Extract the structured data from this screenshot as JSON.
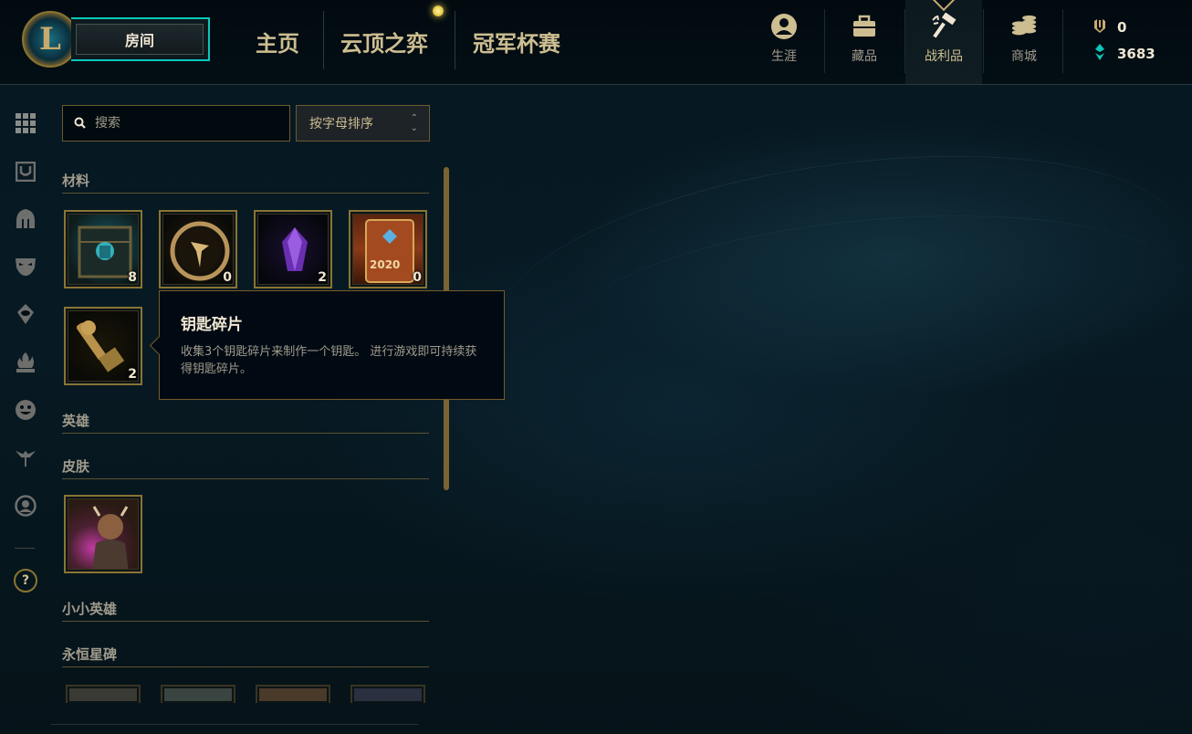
{
  "header": {
    "play_button_label": "房间",
    "tabs": [
      {
        "label": "主页"
      },
      {
        "label": "云顶之弈"
      },
      {
        "label": "冠军杯赛"
      }
    ],
    "nav_buttons": [
      {
        "label": "生涯",
        "icon": "profile-icon"
      },
      {
        "label": "藏品",
        "icon": "collection-bag-icon"
      },
      {
        "label": "战利品",
        "icon": "loot-hammer-icon",
        "active": true
      },
      {
        "label": "商城",
        "icon": "store-coins-icon"
      }
    ],
    "currency": {
      "rp": "0",
      "blue_essence": "3683"
    }
  },
  "left_rail": {
    "icons": [
      "grid-icon",
      "chest-icon",
      "champion-helmet-icon",
      "skin-mask-icon",
      "ward-icon",
      "emote-flame-icon",
      "emote-face-icon",
      "little-legend-icon",
      "profile-circle-icon"
    ],
    "help_label": "?"
  },
  "toolbar": {
    "search_placeholder": "搜索",
    "sort_label": "按字母排序"
  },
  "sections": {
    "materials": {
      "title": "材料",
      "items": [
        {
          "name": "hextech-chest",
          "count": "8"
        },
        {
          "name": "key-emblem",
          "count": "0"
        },
        {
          "name": "gemstone",
          "count": "2"
        },
        {
          "name": "2020-card",
          "count": "0",
          "art_text": "2020"
        },
        {
          "name": "key-fragment",
          "count": "2"
        }
      ]
    },
    "champions": {
      "title": "英雄"
    },
    "skins": {
      "title": "皮肤",
      "items": [
        {
          "name": "skin-shard"
        }
      ]
    },
    "little_legends": {
      "title": "小小英雄"
    },
    "eternals": {
      "title": "永恒星碑"
    }
  },
  "tooltip": {
    "title": "钥匙碎片",
    "description": "收集3个钥匙碎片来制作一个钥匙。 进行游戏即可持续获得钥匙碎片。"
  },
  "colors": {
    "gold": "#c8aa6e",
    "gold_dark": "#785a28",
    "teal": "#0ac8b9",
    "text_light": "#f0e6d2",
    "text_muted": "#a09b8c",
    "background": "#061720"
  }
}
